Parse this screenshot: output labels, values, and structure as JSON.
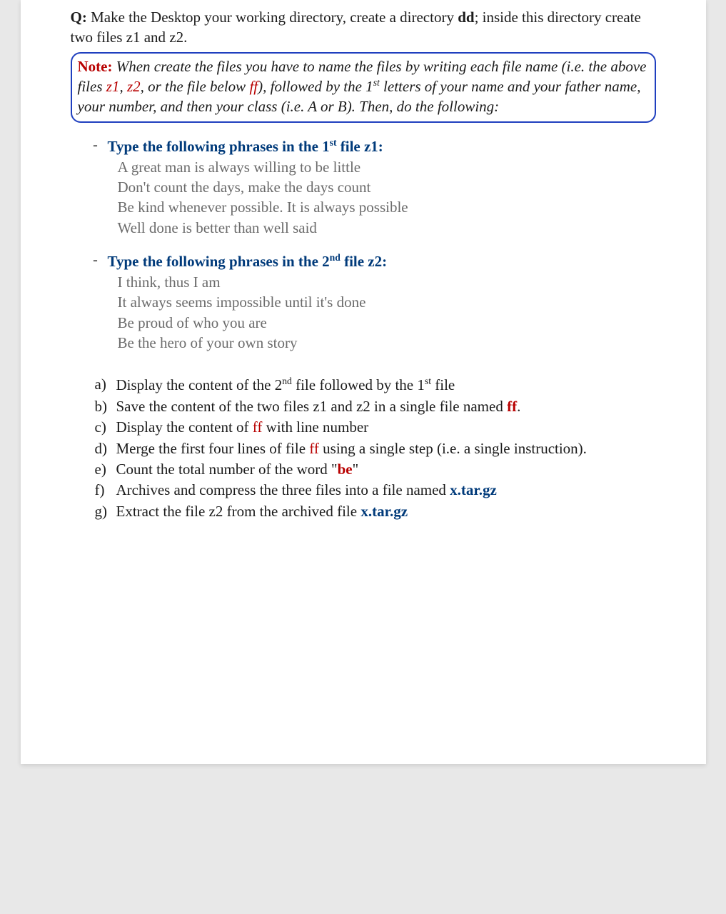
{
  "question": {
    "label": "Q:",
    "text_1": " Make the Desktop your working directory, create a directory ",
    "bold_dd": "dd",
    "text_2": "; inside this directory create two files z1 and z2."
  },
  "note": {
    "label": "Note:",
    "body_1": "  When create the files you have to name the files by writing each file name (i.e. the above files ",
    "z1": "z1",
    "comma1": ", ",
    "z2": "z2",
    "body_2": ", or the file below ",
    "ff": "ff",
    "body_3": "), followed by the 1",
    "sup_st": "st",
    "body_4": " letters of your name and your father name, your number, and then your class (i.e. A or B). Then, do the following:"
  },
  "sec1": {
    "dash": "-",
    "head_1": "Type the following phrases in the 1",
    "sup": "st",
    "head_2": "  file z1:",
    "lines": {
      "l1": "A great man is always willing to be little",
      "l2": "Don't count the days, make the days count",
      "l3": "Be kind whenever possible. It is always possible",
      "l4": "Well done is better than well said"
    }
  },
  "sec2": {
    "dash": "-",
    "head_1": "Type the following phrases in the  2",
    "sup": "nd",
    "head_2": " file z2:",
    "lines": {
      "l1": "I think, thus I am",
      "l2": "It always seems impossible until it's done",
      "l3": "Be proud of who you are",
      "l4": "Be the hero of your own story"
    }
  },
  "tasks": {
    "a": {
      "label": "a)",
      "t1": "Display the content of the 2",
      "sup1": "nd",
      "t2": " file followed by the 1",
      "sup2": "st",
      "t3": " file"
    },
    "b": {
      "label": "b)",
      "t1": "Save the content of the two files z1 and z2 in a single file named ",
      "ff": "ff",
      "dot": "."
    },
    "c": {
      "label": "c)",
      "t1": "Display the content of ",
      "ff": "ff",
      "t2": " with line number"
    },
    "d": {
      "label": "d)",
      "t1": "Merge the first four lines of file ",
      "ff": "ff",
      "t2": " using a single step (i.e. a single instruction)."
    },
    "e": {
      "label": "e)",
      "t1": "Count the total number of the word \"",
      "be": "be",
      "t2": "\""
    },
    "f": {
      "label": "f)",
      "t1": "Archives and compress the three files into a file named ",
      "tar": "x.tar.gz"
    },
    "g": {
      "label": "g)",
      "t1": "Extract the file z2 from the archived file ",
      "tar": "x.tar.gz"
    }
  }
}
